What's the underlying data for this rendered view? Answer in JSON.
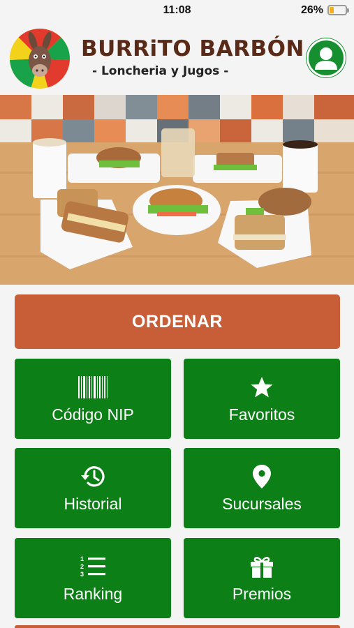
{
  "status": {
    "time": "11:08",
    "battery": "26%"
  },
  "brand": {
    "title": "BURRiTO BARBÓN",
    "subtitle": "- Loncheria y Jugos -"
  },
  "colors": {
    "accent_green": "#0c7f17",
    "order_orange": "#c75e38",
    "brand_brown": "#5a2a18"
  },
  "order_label": "ORDENAR",
  "tiles": [
    {
      "label": "Código NIP",
      "icon": "barcode-icon"
    },
    {
      "label": "Favoritos",
      "icon": "star-icon"
    },
    {
      "label": "Historial",
      "icon": "history-icon"
    },
    {
      "label": "Sucursales",
      "icon": "location-pin-icon"
    },
    {
      "label": "Ranking",
      "icon": "ranked-list-icon"
    },
    {
      "label": "Premios",
      "icon": "gift-icon"
    }
  ]
}
